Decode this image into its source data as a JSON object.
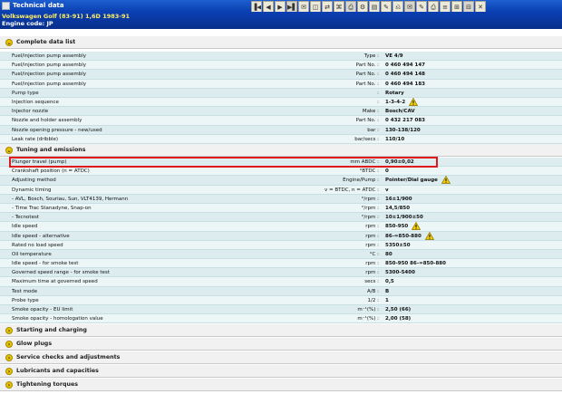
{
  "window": {
    "title": "Technical data"
  },
  "toolbar": {
    "buttons": [
      "▐◀",
      "◀",
      "▶",
      "▶▌",
      "✉",
      "◫",
      "⇄",
      "⌘",
      "⎙",
      "⚙",
      "▤",
      "✎",
      "⎌",
      "✉",
      "✎",
      "⎙",
      "≡",
      "⊞",
      "⊟",
      "✕"
    ]
  },
  "vehicle": {
    "name": "Volkswagen   Golf (83-91) 1,6D   1983-91",
    "engine_code": "Engine code: JP"
  },
  "sections": {
    "complete": "Complete data list",
    "tuning": "Tuning and emissions",
    "starting": "Starting and charging",
    "glow": "Glow plugs",
    "service": "Service checks and adjustments",
    "lubricants": "Lubricants and capacities",
    "tightening": "Tightening torques"
  },
  "complete_rows": [
    {
      "label": "Fuel/injection pump assembly",
      "unit": "Type :",
      "value": "VE 4/9"
    },
    {
      "label": "Fuel/injection pump assembly",
      "unit": "Part No. :",
      "value": "0 460 494 147"
    },
    {
      "label": "Fuel/injection pump assembly",
      "unit": "Part No. :",
      "value": "0 460 494 148"
    },
    {
      "label": "Fuel/injection pump assembly",
      "unit": "Part No. :",
      "value": "0 460 494 183"
    },
    {
      "label": "Pump type",
      "unit": ":",
      "value": "Rotary"
    },
    {
      "label": "Injection sequence",
      "unit": ":",
      "value": "1-3-4-2",
      "warn": true
    },
    {
      "label": "Injector nozzle",
      "unit": "Make :",
      "value": "Bosch/CAV"
    },
    {
      "label": "Nozzle and holder assembly",
      "unit": "Part No. :",
      "value": "0 432 217 083"
    },
    {
      "label": "Nozzle opening pressure - new/used",
      "unit": "bar :",
      "value": "130-138/120"
    },
    {
      "label": "Leak rate (dribble)",
      "unit": "bar/secs :",
      "value": "110/10"
    }
  ],
  "tuning_rows": [
    {
      "label": "Plunger travel (pump)",
      "unit": "mm ABDC :",
      "value": "0,90±0,02"
    },
    {
      "label": "Crankshaft position (n = ATDC)",
      "unit": "°BTDC :",
      "value": "0"
    },
    {
      "label": "Adjusting method",
      "unit": "Engine/Pump :",
      "value": "Pointer/Dial gauge",
      "warn": true
    },
    {
      "label": "Dynamic timing",
      "unit": "v = BTDC, n = ATDC :",
      "value": "v"
    },
    {
      "label": "- AVL, Bosch, Souriau, Sun, VLT4139, Hermann",
      "unit": "°/rpm :",
      "value": "16±1/900"
    },
    {
      "label": "- Time Trac Stanadyne, Snap-on",
      "unit": "°/rpm :",
      "value": "14,5/850"
    },
    {
      "label": "- Tecnotest",
      "unit": "°/rpm :",
      "value": "10±1/900±50"
    },
    {
      "label": "Idle speed",
      "unit": "rpm :",
      "value": "850-950",
      "warn": true
    },
    {
      "label": "Idle speed - alternative",
      "unit": "rpm :",
      "value": "86-=850-880",
      "warn": true
    },
    {
      "label": "Rated no load speed",
      "unit": "rpm :",
      "value": "5350±50"
    },
    {
      "label": "Oil temperature",
      "unit": "°C :",
      "value": "80"
    },
    {
      "label": "Idle speed - for smoke test",
      "unit": "rpm :",
      "value": "850-950 86-=850-880"
    },
    {
      "label": "Governed speed range - for smoke test",
      "unit": "rpm :",
      "value": "5300-5400"
    },
    {
      "label": "Maximum time at governed speed",
      "unit": "secs :",
      "value": "0,5"
    },
    {
      "label": "Test mode",
      "unit": "A/B :",
      "value": "B"
    },
    {
      "label": "Probe type",
      "unit": "1/2 :",
      "value": "1"
    },
    {
      "label": "Smoke opacity - EU limit",
      "unit": "m⁻¹(%) :",
      "value": "2,50 (66)"
    },
    {
      "label": "Smoke opacity - homologation value",
      "unit": "m⁻¹(%) :",
      "value": "2,00 (58)"
    }
  ],
  "colors": {
    "title_bar": "#0a3fb0",
    "vehicle_name": "#ffee66",
    "row_a": "#dcecef",
    "row_b": "#ecf6f7",
    "highlight": "#e01a1a",
    "warn": "#f5d000"
  }
}
